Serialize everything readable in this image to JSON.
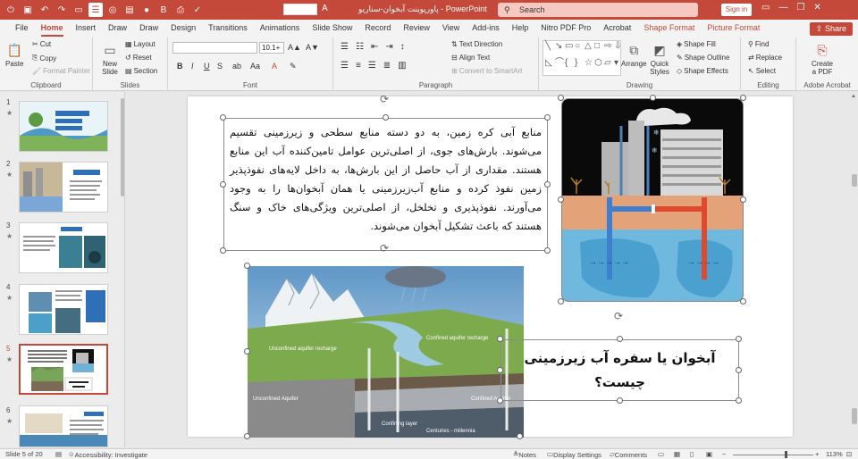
{
  "titlebar": {
    "document": "پاورپوینت آبخوان-سناریو",
    "app": "PowerPoint",
    "search_placeholder": "Search",
    "signin": "Sign in",
    "font_name": "",
    "font_size": "10.1+"
  },
  "tabs": [
    "File",
    "Home",
    "Insert",
    "Draw",
    "Draw",
    "Design",
    "Transitions",
    "Animations",
    "Slide Show",
    "Record",
    "Review",
    "View",
    "Add-ins",
    "Help",
    "Nitro PDF Pro",
    "Acrobat",
    "Shape Format",
    "Picture Format"
  ],
  "share": "Share",
  "ribbon": {
    "clipboard": {
      "label": "Clipboard",
      "paste": "Paste",
      "cut": "Cut",
      "copy": "Copy",
      "format_painter": "Format Painter"
    },
    "slides": {
      "label": "Slides",
      "new_slide": "New Slide",
      "layout": "Layout",
      "reset": "Reset",
      "section": "Section"
    },
    "font": {
      "label": "Font"
    },
    "paragraph": {
      "label": "Paragraph",
      "text_direction": "Text Direction",
      "align_text": "Align Text",
      "smartart": "Convert to SmartArt"
    },
    "drawing": {
      "label": "Drawing",
      "arrange": "Arrange",
      "quick_styles": "Quick Styles",
      "shape_fill": "Shape Fill",
      "shape_outline": "Shape Outline",
      "shape_effects": "Shape Effects"
    },
    "editing": {
      "label": "Editing",
      "find": "Find",
      "replace": "Replace",
      "select": "Select"
    },
    "acrobat": {
      "label": "Adobe Acrobat",
      "create_pdf": "Create a PDF"
    }
  },
  "thumbnails": [
    {
      "num": "1",
      "star": "★"
    },
    {
      "num": "2",
      "star": "★"
    },
    {
      "num": "3",
      "star": "★"
    },
    {
      "num": "4",
      "star": "★"
    },
    {
      "num": "5",
      "star": "★"
    },
    {
      "num": "6",
      "star": "★"
    }
  ],
  "slide": {
    "body": "منابع آبی کره زمین، به دو دسته منابع سطحی و زیرزمینی تقسیم می‌شوند. بارش‌های جوی، از اصلی‌ترین عوامل تامین‌کننده آب این منابع هستند. مقداری از آب حاصل از این بارش‌ها، به داخل لایه‌های نفوذپذیر زمین نفوذ کرده و منابع آب‌زیرزمینی یا همان آبخوان‌ها را به وجود می‌آورند. نفوذپذیری و تخلخل، از اصلی‌ترین ویژگی‌های خاک و سنگ هستند که باعث تشکیل آبخوان می‌شوند.",
    "title": "آبخوان یا سفره آب زیرزمینی چیست؟",
    "diagram_labels": [
      "Unconfined aquifer recharge",
      "Unconfined Aquifer",
      "Confined aquifer recharge",
      "Confined Aquifer",
      "Confining layer",
      "Centuries - millennia"
    ]
  },
  "status": {
    "slide": "Slide 5 of 20",
    "accessibility": "Accessibility: Investigate",
    "notes": "Notes",
    "display": "Display Settings",
    "comments": "Comments",
    "zoom": "113%"
  },
  "colors": {
    "accent": "#c4493a",
    "ribbon": "#f3f3f3"
  }
}
